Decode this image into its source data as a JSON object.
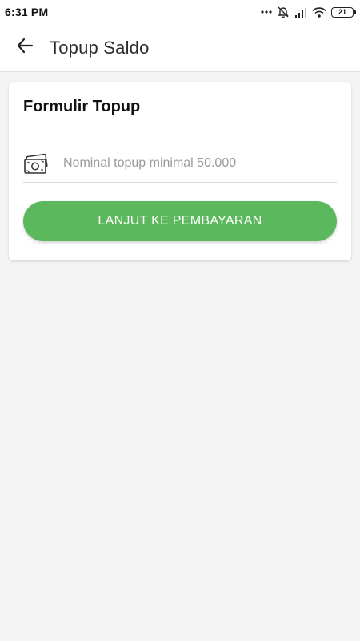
{
  "status_bar": {
    "time": "6:31 PM",
    "battery": "21",
    "icons": [
      "more-dots-icon",
      "alarm-off-icon",
      "signal-icon",
      "wifi-icon",
      "battery-icon"
    ]
  },
  "app_bar": {
    "title": "Topup Saldo",
    "back_icon": "arrow-left-icon"
  },
  "form": {
    "title": "Formulir Topup",
    "amount_icon": "money-icon",
    "amount_value": "",
    "amount_placeholder": "Nominal topup minimal 50.000",
    "submit_label": "LANJUT KE PEMBAYARAN"
  },
  "colors": {
    "accent": "#5cb85c",
    "background": "#f4f4f4",
    "surface": "#ffffff"
  }
}
